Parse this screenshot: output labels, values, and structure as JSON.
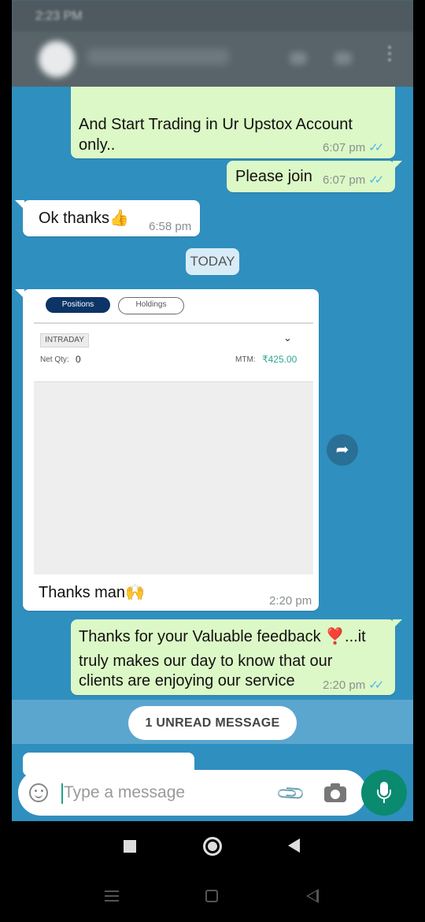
{
  "status_bar": {
    "time": "2:23 PM",
    "icon": "do-not-disturb-icon"
  },
  "app_bar": {
    "icons": [
      "avatar",
      "video-call-icon",
      "voice-call-icon",
      "more-options-icon"
    ]
  },
  "messages": [
    {
      "type": "outgoing",
      "text": "And Start Trading in Ur Upstox Account only..",
      "time": "6:07 pm",
      "ticks": "read"
    },
    {
      "type": "outgoing",
      "text": "Please join",
      "time": "6:07 pm",
      "ticks": "read"
    },
    {
      "type": "incoming",
      "text": "Ok thanks👍",
      "time": "6:58 pm"
    }
  ],
  "date_chip": "TODAY",
  "screenshot_card": {
    "tabs": [
      {
        "label": "Positions",
        "active": true
      },
      {
        "label": "Holdings",
        "active": false
      }
    ],
    "segment": "INTRADAY",
    "net_qty_label": "Net Qty:",
    "net_qty_value": "0",
    "mtm_label": "MTM:",
    "mtm_value": "₹425.00",
    "caption": "Thanks man🙌",
    "time": "2:20 pm"
  },
  "reply": {
    "line1": "Thanks for your Valuable feedback ❣️...it",
    "line2": "truly makes our day to know that our",
    "line3": "clients are enjoying our service",
    "time": "2:20 pm",
    "ticks": "read"
  },
  "unread_label": "1 UNREAD MESSAGE",
  "input": {
    "placeholder": "Type a message"
  },
  "colors": {
    "chat_bg": "#2f8fbf",
    "outgoing": "#dcf8c6",
    "accent": "#0a8a6f",
    "mtm_green": "#2ea890"
  }
}
